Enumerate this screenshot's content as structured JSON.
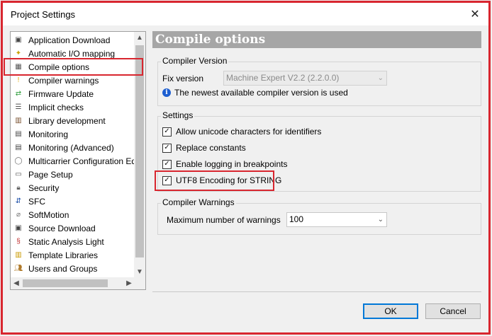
{
  "window": {
    "title": "Project Settings"
  },
  "sidebar": {
    "items": [
      {
        "label": "Application Download",
        "icon": "app-download-icon",
        "glyph": "▣",
        "color": "#444444"
      },
      {
        "label": "Automatic I/O mapping",
        "icon": "io-mapping-icon",
        "glyph": "✦",
        "color": "#c9a400"
      },
      {
        "label": "Compile options",
        "icon": "compile-options-icon",
        "glyph": "▦",
        "color": "#555555"
      },
      {
        "label": "Compiler warnings",
        "icon": "warning-icon",
        "glyph": "!",
        "color": "#e0a800"
      },
      {
        "label": "Firmware Update",
        "icon": "firmware-icon",
        "glyph": "⇄",
        "color": "#2e9e3c"
      },
      {
        "label": "Implicit checks",
        "icon": "implicit-checks-icon",
        "glyph": "☰",
        "color": "#555555"
      },
      {
        "label": "Library development",
        "icon": "library-icon",
        "glyph": "▥",
        "color": "#7a5230"
      },
      {
        "label": "Monitoring",
        "icon": "monitoring-icon",
        "glyph": "▤",
        "color": "#444444"
      },
      {
        "label": "Monitoring (Advanced)",
        "icon": "monitoring-advanced-icon",
        "glyph": "▤",
        "color": "#444444"
      },
      {
        "label": "Multicarrier Configuration Edito",
        "icon": "multicarrier-icon",
        "glyph": "◯",
        "color": "#6a6a6a"
      },
      {
        "label": "Page Setup",
        "icon": "page-setup-icon",
        "glyph": "▭",
        "color": "#555555"
      },
      {
        "label": "Security",
        "icon": "security-lock-icon",
        "glyph": "🔒︎",
        "color": "#666666"
      },
      {
        "label": "SFC",
        "icon": "sfc-icon",
        "glyph": "⇵",
        "color": "#1d4fa8"
      },
      {
        "label": "SoftMotion",
        "icon": "softmotion-icon",
        "glyph": "⌀",
        "color": "#777777"
      },
      {
        "label": "Source Download",
        "icon": "source-download-icon",
        "glyph": "▣",
        "color": "#444444"
      },
      {
        "label": "Static Analysis Light",
        "icon": "static-analysis-icon",
        "glyph": "§",
        "color": "#c03030"
      },
      {
        "label": "Template Libraries",
        "icon": "template-libraries-icon",
        "glyph": "▥",
        "color": "#c99a00"
      },
      {
        "label": "Users and Groups",
        "icon": "users-groups-icon",
        "glyph": "👥︎",
        "color": "#b07a2a"
      }
    ],
    "selected": "Compile options"
  },
  "main": {
    "header": "Compile options",
    "compiler_version": {
      "group_title": "Compiler Version",
      "fix_version_label": "Fix version",
      "fix_version_value": "Machine Expert V2.2 (2.2.0.0)",
      "info_text": "The newest available compiler version is used"
    },
    "settings": {
      "group_title": "Settings",
      "options": [
        {
          "label": "Allow unicode characters for identifiers",
          "checked": true
        },
        {
          "label": "Replace constants",
          "checked": true
        },
        {
          "label": "Enable logging in breakpoints",
          "checked": true
        },
        {
          "label": "UTF8 Encoding for STRING",
          "checked": true
        }
      ]
    },
    "compiler_warnings": {
      "group_title": "Compiler Warnings",
      "max_label": "Maximum number of warnings",
      "max_value": "100"
    }
  },
  "footer": {
    "ok_label": "OK",
    "cancel_label": "Cancel"
  },
  "colors": {
    "highlight": "#d8262f",
    "header_bg": "#a6a6a6",
    "info_blue": "#1d5fd1"
  }
}
